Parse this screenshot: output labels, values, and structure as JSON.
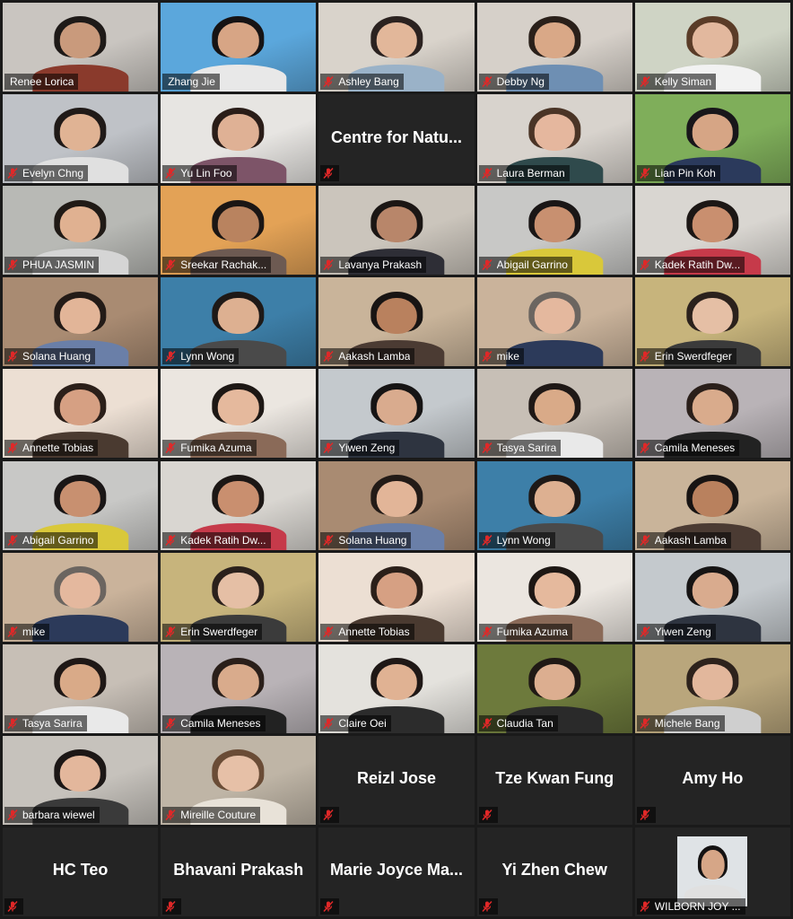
{
  "meeting": {
    "tiles": [
      {
        "name": "Renee Lorica",
        "muted": false,
        "bg": "#c9c5c0",
        "skin": "#c99a7c",
        "hair": "#1e1a18",
        "shirt": "#8a3a2c"
      },
      {
        "name": "Zhang Jie",
        "muted": false,
        "active": true,
        "bg": "#5ba7dc",
        "skin": "#d7a585",
        "hair": "#161314",
        "shirt": "#e8e8e8"
      },
      {
        "name": "Ashley Bang",
        "muted": true,
        "bg": "#d9d3cb",
        "skin": "#e2b79a",
        "hair": "#2b2220",
        "shirt": "#9ab2c8"
      },
      {
        "name": "Debby Ng",
        "muted": true,
        "bg": "#d6d0c9",
        "skin": "#d9a887",
        "hair": "#2a201a",
        "shirt": "#6e8fb3"
      },
      {
        "name": "Kelly Siman",
        "muted": true,
        "bg": "#cfd4c5",
        "skin": "#e2b89e",
        "hair": "#5a3c28",
        "shirt": "#f2f2f2"
      },
      {
        "name": "Evelyn Chng",
        "muted": true,
        "bg": "#bfc2c7",
        "skin": "#e0b394",
        "hair": "#201a18",
        "shirt": "#e0e0e0"
      },
      {
        "name": "Yu Lin Foo",
        "muted": true,
        "bg": "#e7e5e2",
        "skin": "#dfb195",
        "hair": "#2a1d18",
        "shirt": "#7d5468"
      },
      {
        "name": "Centre for Natu...",
        "muted": true,
        "noimg": true
      },
      {
        "name": "Laura Berman",
        "muted": true,
        "bg": "#d8d3cd",
        "skin": "#e5b79e",
        "hair": "#4a3426",
        "shirt": "#2f4a4c"
      },
      {
        "name": "Lian Pin Koh",
        "muted": true,
        "bg": "#7fae5a",
        "skin": "#d6a585",
        "hair": "#18161a",
        "shirt": "#2b3a5c"
      },
      {
        "name": "PHUA JASMIN",
        "muted": true,
        "bg": "#b8b9b5",
        "skin": "#e0b191",
        "hair": "#201a16",
        "shirt": "#d5d5d5"
      },
      {
        "name": "Sreekar Rachak...",
        "muted": true,
        "bg": "#e3a256",
        "skin": "#b9835f",
        "hair": "#1b1614",
        "shirt": "#6d5a52"
      },
      {
        "name": "Lavanya Prakash",
        "muted": true,
        "bg": "#cbc5bc",
        "skin": "#b8866a",
        "hair": "#1b1614",
        "shirt": "#2e2e36"
      },
      {
        "name": "Abigail Garrino",
        "muted": true,
        "bg": "#c8c8c6",
        "skin": "#c89070",
        "hair": "#1a1616",
        "shirt": "#d9c83a"
      },
      {
        "name": "Kadek Ratih Dw...",
        "muted": true,
        "bg": "#d9d6d1",
        "skin": "#c98f6f",
        "hair": "#1c1715",
        "shirt": "#c63a4a"
      },
      {
        "name": "Solana Huang",
        "muted": true,
        "bg": "#a98b72",
        "skin": "#e2b598",
        "hair": "#231b17",
        "shirt": "#6a7fa8"
      },
      {
        "name": "Lynn Wong",
        "muted": true,
        "bg": "#3d7fa8",
        "skin": "#ddb091",
        "hair": "#1e1917",
        "shirt": "#4a4a4a"
      },
      {
        "name": "Aakash Lamba",
        "muted": true,
        "bg": "#c9b49a",
        "skin": "#b9815e",
        "hair": "#181413",
        "shirt": "#4b3b33"
      },
      {
        "name": "mike",
        "muted": true,
        "bg": "#cab39b",
        "skin": "#e4b89e",
        "hair": "#6b6560",
        "shirt": "#2c3a5a"
      },
      {
        "name": "Erin Swerdfeger",
        "muted": true,
        "bg": "#c7b47c",
        "skin": "#e5bfa5",
        "hair": "#2b211c",
        "shirt": "#3b3b3b"
      },
      {
        "name": "Annette Tobias",
        "muted": true,
        "bg": "#ecdfd3",
        "skin": "#d6a083",
        "hair": "#2b1f19",
        "shirt": "#4a3a30"
      },
      {
        "name": "Fumika Azuma",
        "muted": true,
        "bg": "#ebe6e0",
        "skin": "#e5b99d",
        "hair": "#1d1714",
        "shirt": "#8a6a58"
      },
      {
        "name": "Yiwen Zeng",
        "muted": true,
        "bg": "#c4c9cd",
        "skin": "#d9ab8e",
        "hair": "#161414",
        "shirt": "#2e3440"
      },
      {
        "name": "Tasya Sarira",
        "muted": true,
        "bg": "#c7bfb6",
        "skin": "#d9aa88",
        "hair": "#1f1816",
        "shirt": "#e9e9e9"
      },
      {
        "name": "Camila Meneses",
        "muted": true,
        "bg": "#b9b3b7",
        "skin": "#d9ab8c",
        "hair": "#2a1f1a",
        "shirt": "#222222"
      },
      {
        "name": "Abigail Garrino",
        "muted": true,
        "bg": "#c8c8c6",
        "skin": "#c89070",
        "hair": "#1a1616",
        "shirt": "#d9c83a"
      },
      {
        "name": "Kadek Ratih Dw...",
        "muted": true,
        "bg": "#d9d6d1",
        "skin": "#c98f6f",
        "hair": "#1c1715",
        "shirt": "#c63a4a"
      },
      {
        "name": "Solana Huang",
        "muted": true,
        "bg": "#a98b72",
        "skin": "#e2b598",
        "hair": "#231b17",
        "shirt": "#6a7fa8"
      },
      {
        "name": "Lynn Wong",
        "muted": true,
        "bg": "#3d7fa8",
        "skin": "#ddb091",
        "hair": "#1e1917",
        "shirt": "#4a4a4a"
      },
      {
        "name": "Aakash Lamba",
        "muted": true,
        "bg": "#c9b49a",
        "skin": "#b9815e",
        "hair": "#181413",
        "shirt": "#4b3b33"
      },
      {
        "name": "mike",
        "muted": true,
        "bg": "#cab39b",
        "skin": "#e4b89e",
        "hair": "#6b6560",
        "shirt": "#2c3a5a"
      },
      {
        "name": "Erin Swerdfeger",
        "muted": true,
        "bg": "#c7b47c",
        "skin": "#e5bfa5",
        "hair": "#2b211c",
        "shirt": "#3b3b3b"
      },
      {
        "name": "Annette Tobias",
        "muted": true,
        "bg": "#ecdfd3",
        "skin": "#d6a083",
        "hair": "#2b1f19",
        "shirt": "#4a3a30"
      },
      {
        "name": "Fumika Azuma",
        "muted": true,
        "bg": "#ebe6e0",
        "skin": "#e5b99d",
        "hair": "#1d1714",
        "shirt": "#8a6a58"
      },
      {
        "name": "Yiwen Zeng",
        "muted": true,
        "bg": "#c4c9cd",
        "skin": "#d9ab8e",
        "hair": "#161414",
        "shirt": "#2e3440"
      },
      {
        "name": "Tasya Sarira",
        "muted": true,
        "bg": "#c7bfb6",
        "skin": "#d9aa88",
        "hair": "#1f1816",
        "shirt": "#e9e9e9"
      },
      {
        "name": "Camila Meneses",
        "muted": true,
        "bg": "#b9b3b7",
        "skin": "#d9ab8c",
        "hair": "#2a1f1a",
        "shirt": "#222222"
      },
      {
        "name": "Claire Oei",
        "muted": true,
        "bg": "#e4e2dd",
        "skin": "#e0b293",
        "hair": "#1f1816",
        "shirt": "#2c2c2c"
      },
      {
        "name": "Claudia Tan",
        "muted": true,
        "bg": "#6d7a3c",
        "skin": "#dcae90",
        "hair": "#201915",
        "shirt": "#2a2a2a"
      },
      {
        "name": "Michele Bang",
        "muted": true,
        "bg": "#b9a67c",
        "skin": "#e2b79c",
        "hair": "#2d221c",
        "shirt": "#cfcfcf"
      },
      {
        "name": "barbara wiewel",
        "muted": true,
        "bg": "#c6c2bc",
        "skin": "#e3b79c",
        "hair": "#1c1716",
        "shirt": "#3a3a3a"
      },
      {
        "name": "Mireille Couture",
        "muted": true,
        "bg": "#bfb5a6",
        "skin": "#e6c0a7",
        "hair": "#6a4c36",
        "shirt": "#e8e2d8"
      },
      {
        "name": "Reizl Jose",
        "muted": true,
        "noimg": true
      },
      {
        "name": "Tze Kwan Fung",
        "muted": true,
        "noimg": true
      },
      {
        "name": "Amy Ho",
        "muted": true,
        "noimg": true
      },
      {
        "name": "HC Teo",
        "muted": true,
        "noimg": true
      },
      {
        "name": "Bhavani Prakash",
        "muted": true,
        "noimg": true
      },
      {
        "name": "Marie Joyce Ma...",
        "muted": true,
        "noimg": true
      },
      {
        "name": "Yi Zhen Chew",
        "muted": true,
        "noimg": true
      },
      {
        "name": "WILBORN JOY ...",
        "muted": true,
        "photo": true,
        "skin": "#d6a687",
        "hair": "#141212",
        "shirt": "#e0e0e0"
      }
    ]
  }
}
